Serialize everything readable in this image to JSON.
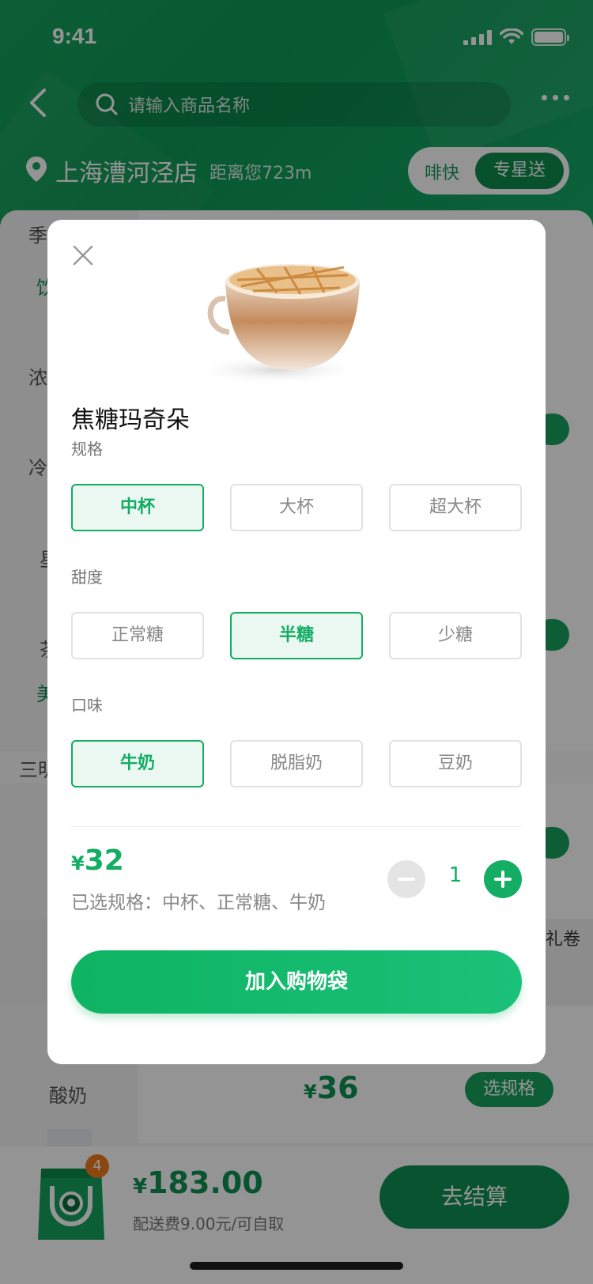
{
  "status_bar": {
    "time": "9:41"
  },
  "search": {
    "placeholder": "请输入商品名称"
  },
  "store": {
    "name": "上海漕河泾店",
    "distance": "距离您723m"
  },
  "delivery_mode": {
    "options": [
      "啡快",
      "专星送"
    ],
    "selected": "专星送"
  },
  "background": {
    "categories": [
      "季",
      "饮",
      "浓",
      "冷",
      "星",
      "茶",
      "美",
      "三明"
    ],
    "voucher_label": "礼卷",
    "product_label": "酸奶",
    "product_price": "36",
    "product_spec_button": "选规格"
  },
  "cart": {
    "count": "4",
    "currency": "¥",
    "total": "183.00",
    "delivery_note": "配送费9.00元/可自取",
    "checkout_label": "去结算"
  },
  "modal": {
    "product_name": "焦糖玛奇朵",
    "sections": [
      {
        "label": "规格",
        "options": [
          "中杯",
          "大杯",
          "超大杯"
        ],
        "selected": "中杯"
      },
      {
        "label": "甜度",
        "options": [
          "正常糖",
          "半糖",
          "少糖"
        ],
        "selected": "半糖"
      },
      {
        "label": "口味",
        "options": [
          "牛奶",
          "脱脂奶",
          "豆奶"
        ],
        "selected": "牛奶"
      }
    ],
    "currency": "¥",
    "price": "32",
    "selected_spec": "已选规格：中杯、正常糖、牛奶",
    "quantity": "1",
    "add_to_bag_label": "加入购物袋"
  },
  "colors": {
    "brand_green": "#13ad64",
    "dark_green": "#0f9254",
    "badge_orange": "#f07b1a"
  }
}
